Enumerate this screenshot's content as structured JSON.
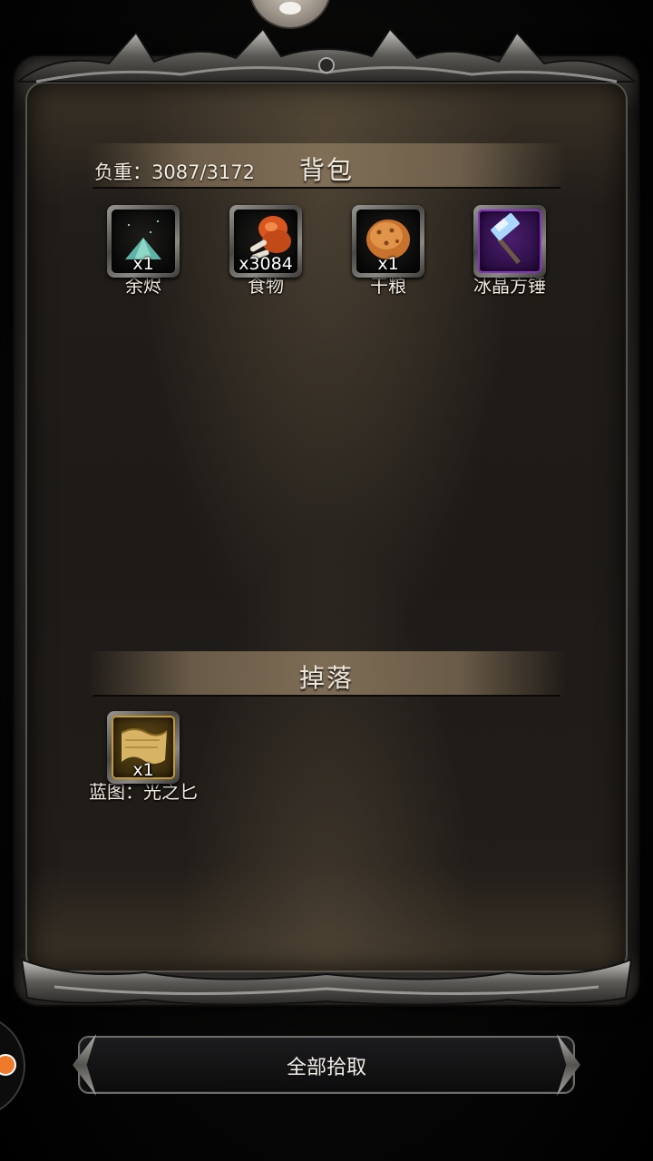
{
  "backpack": {
    "title": "背包",
    "weight_label": "负重：3087/3172",
    "items": [
      {
        "name": "余烬",
        "qty": "x1",
        "icon": "ember-pile-icon",
        "rarity": "normal"
      },
      {
        "name": "食物",
        "qty": "x3084",
        "icon": "meat-drumstick-icon",
        "rarity": "normal"
      },
      {
        "name": "干粮",
        "qty": "x1",
        "icon": "ration-biscuit-icon",
        "rarity": "normal"
      },
      {
        "name": "冰晶方锤",
        "qty": "",
        "icon": "ice-hammer-icon",
        "rarity": "epic"
      }
    ]
  },
  "drops": {
    "title": "掉落",
    "items": [
      {
        "name": "蓝图：光之匕",
        "qty": "x1",
        "icon": "blueprint-scroll-icon",
        "rarity": "legendary"
      }
    ]
  },
  "pickup_all_label": "全部拾取",
  "colors": {
    "epic_border": "#8a2fc4",
    "legendary_border": "#c89a2a",
    "header_bar": "#82704f"
  }
}
